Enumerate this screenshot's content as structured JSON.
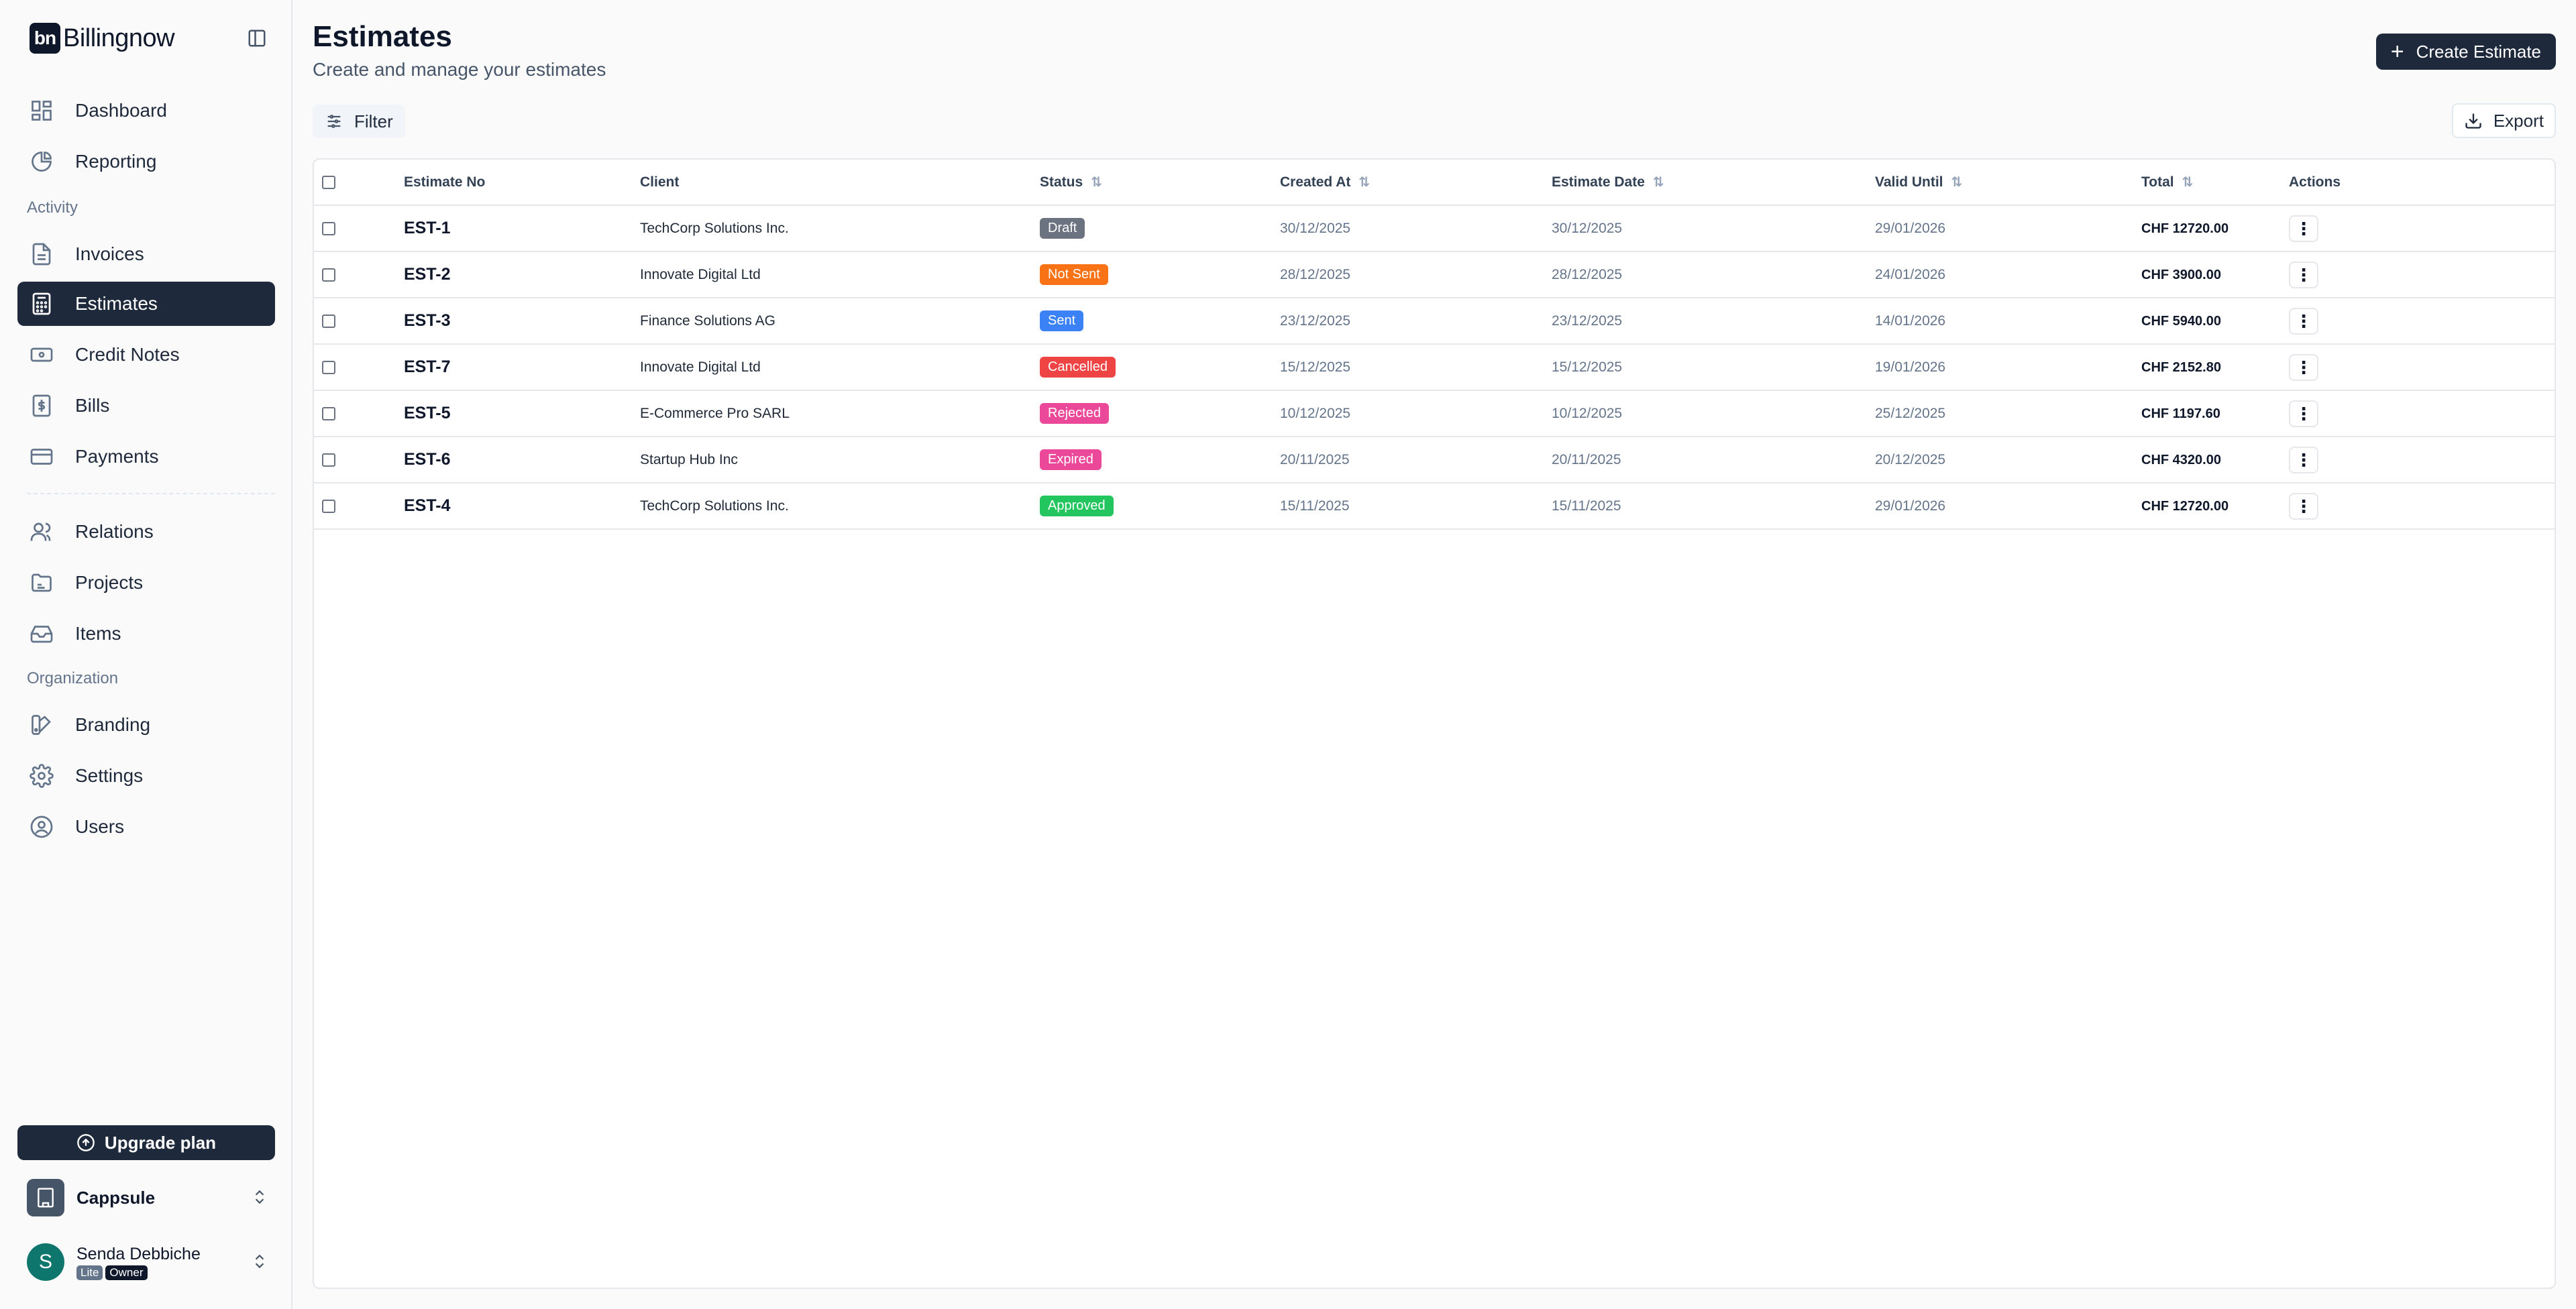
{
  "brand": {
    "mark": "bn",
    "name": "Billingnow"
  },
  "sidebar": {
    "top_items": [
      {
        "label": "Dashboard",
        "icon": "dashboard-icon"
      },
      {
        "label": "Reporting",
        "icon": "pie-chart-icon"
      }
    ],
    "activity_label": "Activity",
    "activity_items": [
      {
        "label": "Invoices",
        "icon": "file-text-icon"
      },
      {
        "label": "Estimates",
        "icon": "calculator-icon",
        "active": true
      },
      {
        "label": "Credit Notes",
        "icon": "receipt-icon"
      },
      {
        "label": "Bills",
        "icon": "dollar-file-icon"
      },
      {
        "label": "Payments",
        "icon": "credit-card-icon"
      }
    ],
    "more_items": [
      {
        "label": "Relations",
        "icon": "users-icon"
      },
      {
        "label": "Projects",
        "icon": "folder-icon"
      },
      {
        "label": "Items",
        "icon": "inbox-icon"
      }
    ],
    "organization_label": "Organization",
    "org_items": [
      {
        "label": "Branding",
        "icon": "swatch-icon"
      },
      {
        "label": "Settings",
        "icon": "gear-icon"
      },
      {
        "label": "Users",
        "icon": "user-circle-icon"
      }
    ],
    "upgrade_label": "Upgrade plan",
    "org_name": "Cappsule",
    "user": {
      "initial": "S",
      "name": "Senda Debbiche",
      "plan": "Lite",
      "role": "Owner"
    }
  },
  "header": {
    "title": "Estimates",
    "subtitle": "Create and manage your estimates",
    "create_label": "Create Estimate",
    "filter_label": "Filter",
    "export_label": "Export"
  },
  "table": {
    "columns": [
      "Estimate No",
      "Client",
      "Status",
      "Created At",
      "Estimate Date",
      "Valid Until",
      "Total",
      "Actions"
    ],
    "rows": [
      {
        "no": "EST-1",
        "client": "TechCorp Solutions Inc.",
        "status": "Draft",
        "status_color": "#6b7280",
        "created": "30/12/2025",
        "date": "30/12/2025",
        "valid": "29/01/2026",
        "total": "CHF 12720.00"
      },
      {
        "no": "EST-2",
        "client": "Innovate Digital Ltd",
        "status": "Not Sent",
        "status_color": "#f97316",
        "created": "28/12/2025",
        "date": "28/12/2025",
        "valid": "24/01/2026",
        "total": "CHF 3900.00"
      },
      {
        "no": "EST-3",
        "client": "Finance Solutions AG",
        "status": "Sent",
        "status_color": "#3b82f6",
        "created": "23/12/2025",
        "date": "23/12/2025",
        "valid": "14/01/2026",
        "total": "CHF 5940.00"
      },
      {
        "no": "EST-7",
        "client": "Innovate Digital Ltd",
        "status": "Cancelled",
        "status_color": "#ef4444",
        "created": "15/12/2025",
        "date": "15/12/2025",
        "valid": "19/01/2026",
        "total": "CHF 2152.80"
      },
      {
        "no": "EST-5",
        "client": "E-Commerce Pro SARL",
        "status": "Rejected",
        "status_color": "#ec4899",
        "created": "10/12/2025",
        "date": "10/12/2025",
        "valid": "25/12/2025",
        "total": "CHF 1197.60"
      },
      {
        "no": "EST-6",
        "client": "Startup Hub Inc",
        "status": "Expired",
        "status_color": "#ec4899",
        "created": "20/11/2025",
        "date": "20/11/2025",
        "valid": "20/12/2025",
        "total": "CHF 4320.00"
      },
      {
        "no": "EST-4",
        "client": "TechCorp Solutions Inc.",
        "status": "Approved",
        "status_color": "#22c55e",
        "created": "15/11/2025",
        "date": "15/11/2025",
        "valid": "29/01/2026",
        "total": "CHF 12720.00"
      }
    ]
  }
}
